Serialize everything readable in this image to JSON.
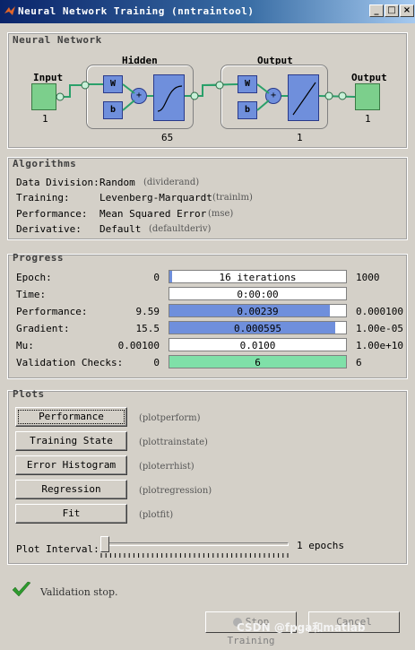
{
  "window": {
    "title": "Neural Network Training (nntraintool)",
    "buttons": {
      "minimize": "_",
      "maximize": "□",
      "close": "×"
    }
  },
  "network": {
    "section_label": "Neural Network",
    "input_label": "Input",
    "input_size": "1",
    "hidden_label": "Hidden",
    "hidden_size": "65",
    "output_layer_label": "Output",
    "output_layer_size": "1",
    "output_label": "Output",
    "output_size": "1",
    "w_label": "W",
    "b_label": "b",
    "plus_label": "+"
  },
  "algorithms": {
    "section_label": "Algorithms",
    "rows": [
      {
        "label": "Data Division:",
        "value": "Random",
        "hint": "(dividerand)"
      },
      {
        "label": "Training:",
        "value": "Levenberg-Marquardt",
        "hint": "(trainlm)"
      },
      {
        "label": "Performance:",
        "value": "Mean Squared Error",
        "hint": "(mse)"
      },
      {
        "label": "Derivative:",
        "value": "Default",
        "hint": "(defaultderiv)"
      }
    ]
  },
  "progress": {
    "section_label": "Progress",
    "rows": [
      {
        "label": "Epoch:",
        "start": "0",
        "current": "16 iterations",
        "end": "1000",
        "fill_fraction": 0.016,
        "fill_color": "#6f8fdc"
      },
      {
        "label": "Time:",
        "start": "",
        "current": "0:00:00",
        "end": "",
        "fill_fraction": 0,
        "fill_color": "#6f8fdc"
      },
      {
        "label": "Performance:",
        "start": "9.59",
        "current": "0.00239",
        "end": "0.000100",
        "fill_fraction": 0.91,
        "fill_color": "#6f8fdc"
      },
      {
        "label": "Gradient:",
        "start": "15.5",
        "current": "0.000595",
        "end": "1.00e-05",
        "fill_fraction": 0.94,
        "fill_color": "#6f8fdc"
      },
      {
        "label": "Mu:",
        "start": "0.00100",
        "current": "0.0100",
        "end": "1.00e+10",
        "fill_fraction": 0.0,
        "fill_color": "#6f8fdc"
      },
      {
        "label": "Validation Checks:",
        "start": "0",
        "current": "6",
        "end": "6",
        "fill_fraction": 1.0,
        "fill_color": "#7fe0a8"
      }
    ]
  },
  "plots": {
    "section_label": "Plots",
    "buttons": [
      {
        "label": "Performance",
        "hint": "(plotperform)"
      },
      {
        "label": "Training State",
        "hint": "(plottrainstate)"
      },
      {
        "label": "Error Histogram",
        "hint": "(ploterrhist)"
      },
      {
        "label": "Regression",
        "hint": "(plotregression)"
      },
      {
        "label": "Fit",
        "hint": "(plotfit)"
      }
    ],
    "interval_label": "Plot Interval:",
    "interval_value": "1 epochs",
    "interval_fraction": 0.0
  },
  "status": {
    "message": "Validation stop.",
    "check_color": "#2e9a2e"
  },
  "footer": {
    "stop_label": "Stop Training",
    "cancel_label": "Cancel",
    "watermark": "CSDN @fpga和matlab"
  }
}
